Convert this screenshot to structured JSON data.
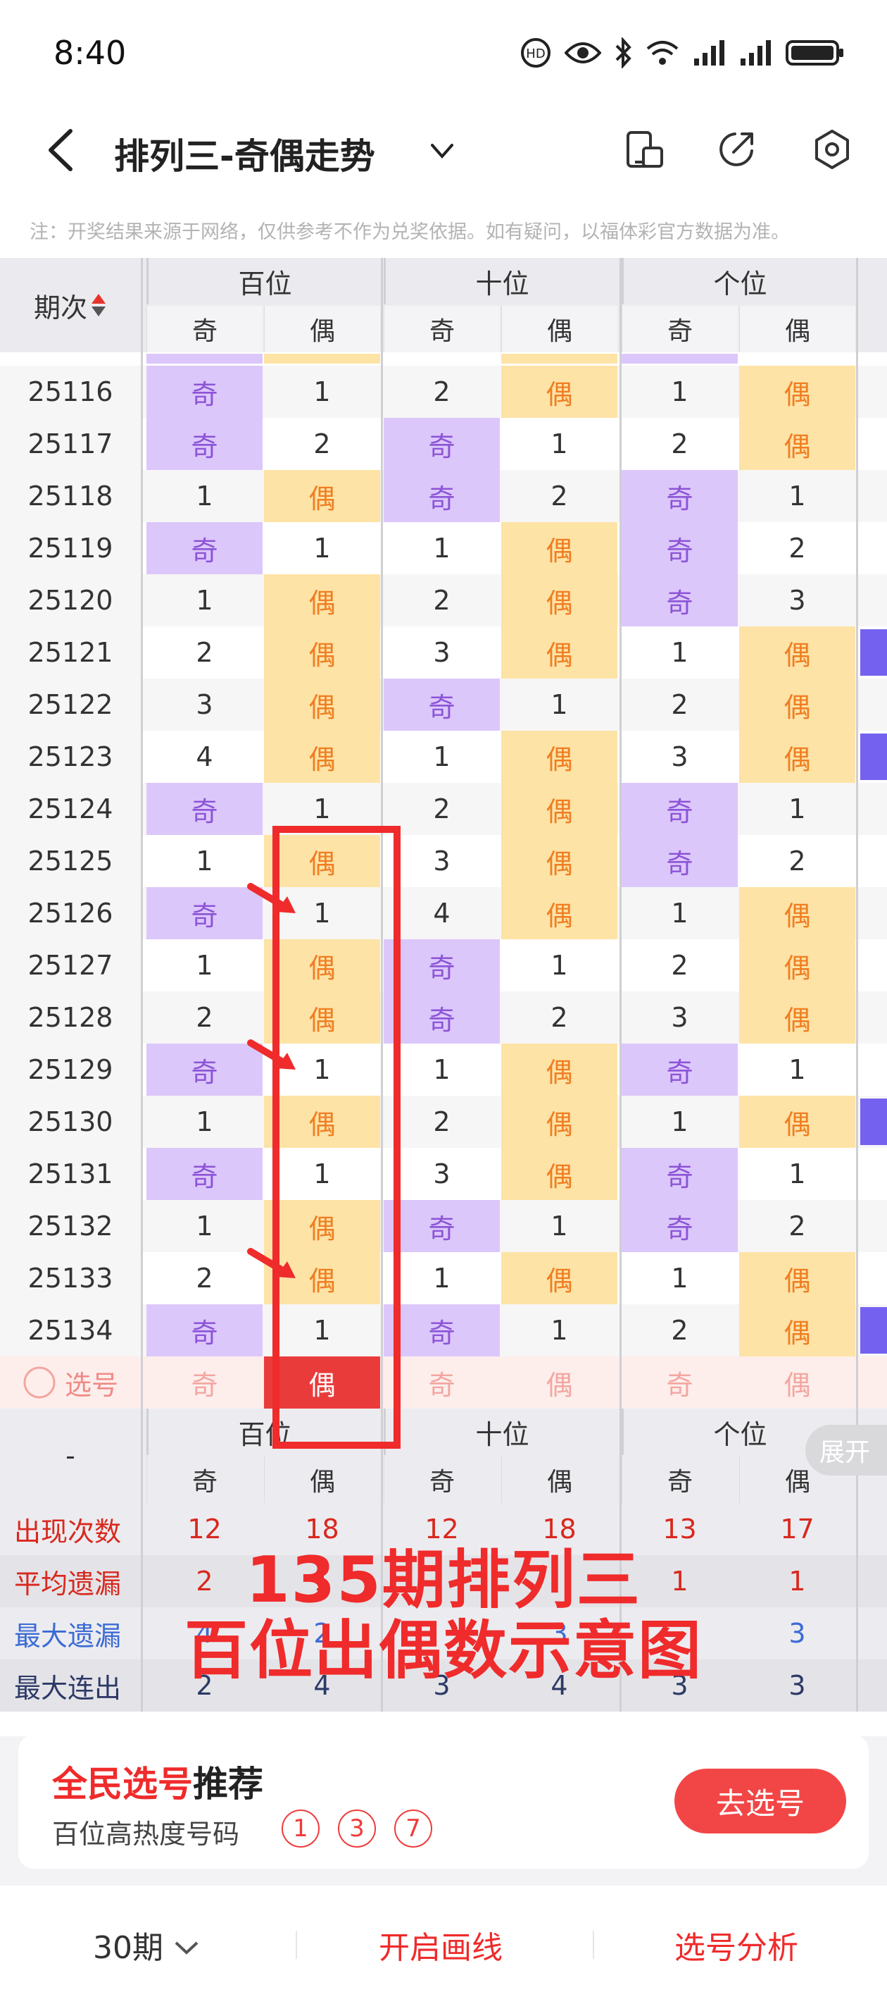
{
  "status_bar": {
    "time": "8:40"
  },
  "header": {
    "title": "排列三-奇偶走势"
  },
  "notice": "注：开奖结果来源于网络，仅供参考不作为兑奖依据。如有疑问，以福体彩官方数据为准。",
  "table": {
    "period_header": "期次",
    "groups": [
      "百位",
      "十位",
      "个位"
    ],
    "sub_headers": [
      "奇",
      "偶",
      "奇",
      "偶",
      "奇",
      "偶"
    ],
    "rows": [
      {
        "period": "25116",
        "cells": [
          [
            "Q",
            "奇"
          ],
          [
            "N",
            "1"
          ],
          [
            "N",
            "2"
          ],
          [
            "O",
            "偶"
          ],
          [
            "N",
            "1"
          ],
          [
            "O",
            "偶"
          ]
        ]
      },
      {
        "period": "25117",
        "cells": [
          [
            "Q",
            "奇"
          ],
          [
            "N",
            "2"
          ],
          [
            "Q",
            "奇"
          ],
          [
            "N",
            "1"
          ],
          [
            "N",
            "2"
          ],
          [
            "O",
            "偶"
          ]
        ]
      },
      {
        "period": "25118",
        "cells": [
          [
            "N",
            "1"
          ],
          [
            "O",
            "偶"
          ],
          [
            "Q",
            "奇"
          ],
          [
            "N",
            "2"
          ],
          [
            "Q",
            "奇"
          ],
          [
            "N",
            "1"
          ]
        ]
      },
      {
        "period": "25119",
        "cells": [
          [
            "Q",
            "奇"
          ],
          [
            "N",
            "1"
          ],
          [
            "N",
            "1"
          ],
          [
            "O",
            "偶"
          ],
          [
            "Q",
            "奇"
          ],
          [
            "N",
            "2"
          ]
        ]
      },
      {
        "period": "25120",
        "cells": [
          [
            "N",
            "1"
          ],
          [
            "O",
            "偶"
          ],
          [
            "N",
            "2"
          ],
          [
            "O",
            "偶"
          ],
          [
            "Q",
            "奇"
          ],
          [
            "N",
            "3"
          ]
        ]
      },
      {
        "period": "25121",
        "cells": [
          [
            "N",
            "2"
          ],
          [
            "O",
            "偶"
          ],
          [
            "N",
            "3"
          ],
          [
            "O",
            "偶"
          ],
          [
            "N",
            "1"
          ],
          [
            "O",
            "偶"
          ]
        ]
      },
      {
        "period": "25122",
        "cells": [
          [
            "N",
            "3"
          ],
          [
            "O",
            "偶"
          ],
          [
            "Q",
            "奇"
          ],
          [
            "N",
            "1"
          ],
          [
            "N",
            "2"
          ],
          [
            "O",
            "偶"
          ]
        ]
      },
      {
        "period": "25123",
        "cells": [
          [
            "N",
            "4"
          ],
          [
            "O",
            "偶"
          ],
          [
            "N",
            "1"
          ],
          [
            "O",
            "偶"
          ],
          [
            "N",
            "3"
          ],
          [
            "O",
            "偶"
          ]
        ]
      },
      {
        "period": "25124",
        "cells": [
          [
            "Q",
            "奇"
          ],
          [
            "N",
            "1"
          ],
          [
            "N",
            "2"
          ],
          [
            "O",
            "偶"
          ],
          [
            "Q",
            "奇"
          ],
          [
            "N",
            "1"
          ]
        ]
      },
      {
        "period": "25125",
        "cells": [
          [
            "N",
            "1"
          ],
          [
            "O",
            "偶"
          ],
          [
            "N",
            "3"
          ],
          [
            "O",
            "偶"
          ],
          [
            "Q",
            "奇"
          ],
          [
            "N",
            "2"
          ]
        ]
      },
      {
        "period": "25126",
        "cells": [
          [
            "Q",
            "奇"
          ],
          [
            "N",
            "1"
          ],
          [
            "N",
            "4"
          ],
          [
            "O",
            "偶"
          ],
          [
            "N",
            "1"
          ],
          [
            "O",
            "偶"
          ]
        ]
      },
      {
        "period": "25127",
        "cells": [
          [
            "N",
            "1"
          ],
          [
            "O",
            "偶"
          ],
          [
            "Q",
            "奇"
          ],
          [
            "N",
            "1"
          ],
          [
            "N",
            "2"
          ],
          [
            "O",
            "偶"
          ]
        ]
      },
      {
        "period": "25128",
        "cells": [
          [
            "N",
            "2"
          ],
          [
            "O",
            "偶"
          ],
          [
            "Q",
            "奇"
          ],
          [
            "N",
            "2"
          ],
          [
            "N",
            "3"
          ],
          [
            "O",
            "偶"
          ]
        ]
      },
      {
        "period": "25129",
        "cells": [
          [
            "Q",
            "奇"
          ],
          [
            "N",
            "1"
          ],
          [
            "N",
            "1"
          ],
          [
            "O",
            "偶"
          ],
          [
            "Q",
            "奇"
          ],
          [
            "N",
            "1"
          ]
        ]
      },
      {
        "period": "25130",
        "cells": [
          [
            "N",
            "1"
          ],
          [
            "O",
            "偶"
          ],
          [
            "N",
            "2"
          ],
          [
            "O",
            "偶"
          ],
          [
            "N",
            "1"
          ],
          [
            "O",
            "偶"
          ]
        ]
      },
      {
        "period": "25131",
        "cells": [
          [
            "Q",
            "奇"
          ],
          [
            "N",
            "1"
          ],
          [
            "N",
            "3"
          ],
          [
            "O",
            "偶"
          ],
          [
            "Q",
            "奇"
          ],
          [
            "N",
            "1"
          ]
        ]
      },
      {
        "period": "25132",
        "cells": [
          [
            "N",
            "1"
          ],
          [
            "O",
            "偶"
          ],
          [
            "Q",
            "奇"
          ],
          [
            "N",
            "1"
          ],
          [
            "Q",
            "奇"
          ],
          [
            "N",
            "2"
          ]
        ]
      },
      {
        "period": "25133",
        "cells": [
          [
            "N",
            "2"
          ],
          [
            "O",
            "偶"
          ],
          [
            "N",
            "1"
          ],
          [
            "O",
            "偶"
          ],
          [
            "N",
            "1"
          ],
          [
            "O",
            "偶"
          ]
        ]
      },
      {
        "period": "25134",
        "cells": [
          [
            "Q",
            "奇"
          ],
          [
            "N",
            "1"
          ],
          [
            "Q",
            "奇"
          ],
          [
            "N",
            "1"
          ],
          [
            "N",
            "2"
          ],
          [
            "O",
            "偶"
          ]
        ]
      }
    ],
    "select_row": {
      "label": "选号",
      "cells": [
        "奇",
        "偶",
        "奇",
        "偶",
        "奇",
        "偶"
      ]
    }
  },
  "stats": {
    "dash": "-",
    "groups": [
      "百位",
      "十位",
      "个位"
    ],
    "sub_headers": [
      "奇",
      "偶",
      "奇",
      "偶",
      "奇",
      "偶"
    ],
    "rows": [
      {
        "label": "出现次数",
        "values": [
          "12",
          "18",
          "12",
          "18",
          "13",
          "17"
        ]
      },
      {
        "label": "平均遗漏",
        "values": [
          "2",
          "1",
          "",
          "",
          "1",
          "1"
        ]
      },
      {
        "label": "最大遗漏",
        "values": [
          "4",
          "2",
          "",
          "3",
          "",
          "3"
        ]
      },
      {
        "label": "最大连出",
        "values": [
          "2",
          "4",
          "3",
          "4",
          "3",
          "3"
        ]
      }
    ]
  },
  "annotation": {
    "line1": "135期排列三",
    "line2": "百位出偶数示意图"
  },
  "expand_label": "展开",
  "recommend": {
    "title_red": "全民选号",
    "title_black": "推荐",
    "subtitle": "百位高热度号码",
    "balls": [
      "1",
      "3",
      "7"
    ],
    "button": "去选号"
  },
  "bottom_bar": {
    "periods": "30期",
    "draw_line": "开启画线",
    "analysis": "选号分析"
  },
  "colors": {
    "odd_bg": "#dcc7fb",
    "even_bg": "#fde3a6",
    "accent_red": "#ef2b2b",
    "stat_label_red": "#d9281e",
    "stat_label_blue": "#3c6bd6",
    "stat_label_dark": "#2d3a66"
  }
}
